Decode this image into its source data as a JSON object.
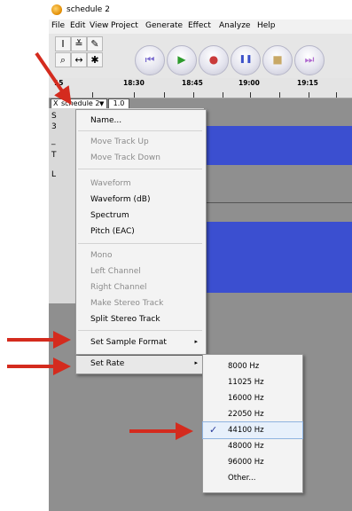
{
  "window": {
    "title": "schedule 2"
  },
  "menubar": {
    "items": [
      "File",
      "Edit",
      "View",
      "Project",
      "Generate",
      "Effect",
      "Analyze",
      "Help"
    ]
  },
  "tools": [
    {
      "icon": "selection-tool-icon",
      "glyph": "I"
    },
    {
      "icon": "envelope-tool-icon",
      "glyph": "≚"
    },
    {
      "icon": "draw-tool-icon",
      "glyph": "✎"
    },
    {
      "icon": "zoom-tool-icon",
      "glyph": "⌕"
    },
    {
      "icon": "timeshift-tool-icon",
      "glyph": "↔"
    },
    {
      "icon": "multi-tool-icon",
      "glyph": "✱"
    }
  ],
  "transport": [
    {
      "name": "skip-start-button",
      "icon": "skip-to-start-icon",
      "glyph": "⏮",
      "color": "#7a6bcf"
    },
    {
      "name": "play-button",
      "icon": "play-icon",
      "glyph": "▶",
      "color": "#2e9b2e"
    },
    {
      "name": "record-button",
      "icon": "record-icon",
      "glyph": "●",
      "color": "#c93a3a"
    },
    {
      "name": "pause-button",
      "icon": "pause-icon",
      "glyph": "❚❚",
      "color": "#3b50c8"
    },
    {
      "name": "stop-button",
      "icon": "stop-icon",
      "glyph": "■",
      "color": "#c8a866"
    },
    {
      "name": "skip-end-button",
      "icon": "skip-to-end-icon",
      "glyph": "⏭",
      "color": "#b06bcf"
    }
  ],
  "ruler": {
    "labels": [
      "15",
      "18:30",
      "18:45",
      "19:00",
      "19:15"
    ]
  },
  "track": {
    "close": "X",
    "name": "schedule 2",
    "dropdown": "▼",
    "scale": "1.0",
    "side_letters": [
      "S",
      "3",
      "_",
      "T",
      "L"
    ]
  },
  "menu": {
    "items": [
      {
        "label": "Name...",
        "enabled": true
      },
      {
        "label": "Move Track Up",
        "enabled": false
      },
      {
        "label": "Move Track Down",
        "enabled": false
      },
      {
        "label": "Waveform",
        "enabled": false
      },
      {
        "label": "Waveform (dB)",
        "enabled": true
      },
      {
        "label": "Spectrum",
        "enabled": true
      },
      {
        "label": "Pitch (EAC)",
        "enabled": true
      },
      {
        "label": "Mono",
        "enabled": false
      },
      {
        "label": "Left Channel",
        "enabled": false
      },
      {
        "label": "Right Channel",
        "enabled": false
      },
      {
        "label": "Make Stereo Track",
        "enabled": false
      },
      {
        "label": "Split Stereo Track",
        "enabled": true
      },
      {
        "label": "Set Sample Format",
        "enabled": true,
        "submenu": true
      },
      {
        "label": "Set Rate",
        "enabled": true,
        "submenu": true
      }
    ],
    "submenu_arrow": "▸"
  },
  "submenu": {
    "items": [
      "8000 Hz",
      "11025 Hz",
      "16000 Hz",
      "22050 Hz",
      "44100 Hz",
      "48000 Hz",
      "96000 Hz",
      "Other..."
    ],
    "checked": "44100 Hz",
    "check_glyph": "✓"
  },
  "colors": {
    "annotation_arrow": "#d42b1e",
    "waveform": "#3b4fd0",
    "background": "#8f8f8f"
  }
}
